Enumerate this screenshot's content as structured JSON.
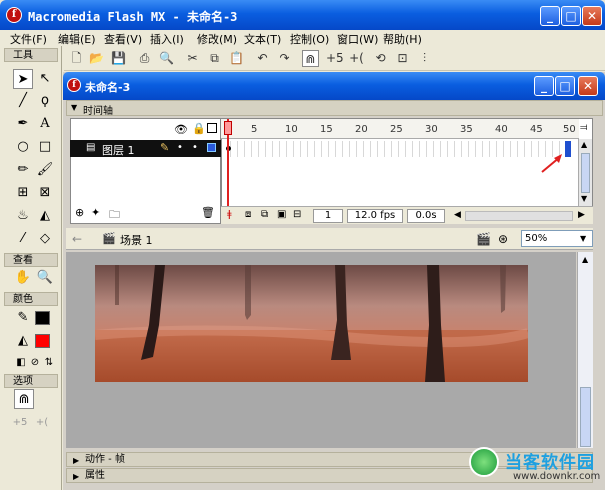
{
  "app": {
    "title": "Macromedia Flash MX - 未命名-3"
  },
  "menu": [
    "文件(F)",
    "编辑(E)",
    "查看(V)",
    "插入(I)",
    "修改(M)",
    "文本(T)",
    "控制(O)",
    "窗口(W)",
    "帮助(H)"
  ],
  "tools": {
    "header": "工具",
    "view_header": "查看",
    "color_header": "颜色",
    "options_header": "选项"
  },
  "document": {
    "title": "未命名-3"
  },
  "timeline": {
    "header": "时间轴",
    "layer_name": "图层 1",
    "ruler_ticks": [
      "1",
      "5",
      "10",
      "15",
      "20",
      "25",
      "30",
      "35",
      "40",
      "45",
      "50"
    ],
    "current_frame": "1",
    "fps": "12.0 fps",
    "time": "0.0s"
  },
  "editbar": {
    "scene": "场景 1",
    "zoom": "50%"
  },
  "panels": {
    "actions": "动作 - 帧",
    "properties": "属性"
  },
  "watermark": {
    "brand": "当客软件园",
    "url": "www.downkr.com"
  },
  "colors": {
    "titlebar": "#0a5ee0",
    "stroke_swatch": "#000000",
    "fill_swatch": "#ff0000",
    "annotation_arrow": "#e02020",
    "keyframe_marker": "#1f4fcf"
  }
}
